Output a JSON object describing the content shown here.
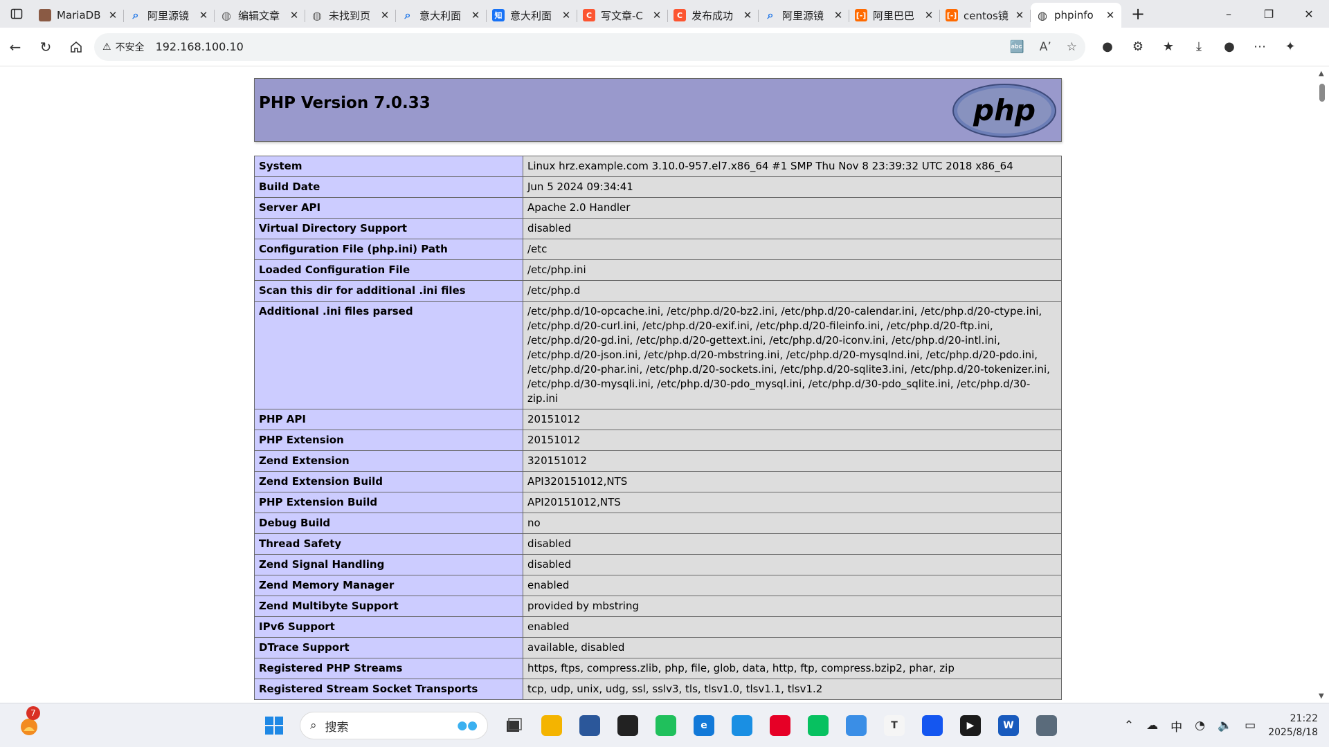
{
  "browser": {
    "tabs": [
      {
        "title": "MariaDB",
        "favicon": "avatar-icon",
        "color": "#8a5a44",
        "glyph": ""
      },
      {
        "title": "阿里源镜",
        "favicon": "search-icon",
        "color": "#1a73e8",
        "glyph": ""
      },
      {
        "title": "编辑文章",
        "favicon": "globe-icon",
        "color": "#666666",
        "glyph": ""
      },
      {
        "title": "未找到页",
        "favicon": "globe-icon",
        "color": "#666666",
        "glyph": ""
      },
      {
        "title": "意大利面",
        "favicon": "search-icon",
        "color": "#1a73e8",
        "glyph": ""
      },
      {
        "title": "意大利面",
        "favicon": "zhihu-icon",
        "color": "#1772f6",
        "glyph": "知"
      },
      {
        "title": "写文章-C",
        "favicon": "csdn-icon",
        "color": "#fc5531",
        "glyph": "C"
      },
      {
        "title": "发布成功",
        "favicon": "csdn-icon",
        "color": "#fc5531",
        "glyph": "C"
      },
      {
        "title": "阿里源镜",
        "favicon": "search-icon",
        "color": "#1a73e8",
        "glyph": ""
      },
      {
        "title": "阿里巴巴",
        "favicon": "aliyun-icon",
        "color": "#ff6a00",
        "glyph": "[-]"
      },
      {
        "title": "centos镜",
        "favicon": "aliyun-icon",
        "color": "#ff6a00",
        "glyph": "[-]"
      },
      {
        "title": "phpinfo",
        "favicon": "globe-icon",
        "color": "#333333",
        "glyph": "",
        "active": true
      }
    ],
    "security_label": "不安全",
    "url": "192.168.100.10"
  },
  "page": {
    "header_title": "PHP Version 7.0.33",
    "logo_text": "php",
    "rows": [
      {
        "k": "System",
        "v": "Linux hrz.example.com 3.10.0-957.el7.x86_64 #1 SMP Thu Nov 8 23:39:32 UTC 2018 x86_64"
      },
      {
        "k": "Build Date",
        "v": "Jun 5 2024 09:34:41"
      },
      {
        "k": "Server API",
        "v": "Apache 2.0 Handler"
      },
      {
        "k": "Virtual Directory Support",
        "v": "disabled"
      },
      {
        "k": "Configuration File (php.ini) Path",
        "v": "/etc"
      },
      {
        "k": "Loaded Configuration File",
        "v": "/etc/php.ini"
      },
      {
        "k": "Scan this dir for additional .ini files",
        "v": "/etc/php.d"
      },
      {
        "k": "Additional .ini files parsed",
        "v": "/etc/php.d/10-opcache.ini, /etc/php.d/20-bz2.ini, /etc/php.d/20-calendar.ini, /etc/php.d/20-ctype.ini, /etc/php.d/20-curl.ini, /etc/php.d/20-exif.ini, /etc/php.d/20-fileinfo.ini, /etc/php.d/20-ftp.ini, /etc/php.d/20-gd.ini, /etc/php.d/20-gettext.ini, /etc/php.d/20-iconv.ini, /etc/php.d/20-intl.ini, /etc/php.d/20-json.ini, /etc/php.d/20-mbstring.ini, /etc/php.d/20-mysqlnd.ini, /etc/php.d/20-pdo.ini, /etc/php.d/20-phar.ini, /etc/php.d/20-sockets.ini, /etc/php.d/20-sqlite3.ini, /etc/php.d/20-tokenizer.ini, /etc/php.d/30-mysqli.ini, /etc/php.d/30-pdo_mysql.ini, /etc/php.d/30-pdo_sqlite.ini, /etc/php.d/30-zip.ini"
      },
      {
        "k": "PHP API",
        "v": "20151012"
      },
      {
        "k": "PHP Extension",
        "v": "20151012"
      },
      {
        "k": "Zend Extension",
        "v": "320151012"
      },
      {
        "k": "Zend Extension Build",
        "v": "API320151012,NTS"
      },
      {
        "k": "PHP Extension Build",
        "v": "API20151012,NTS"
      },
      {
        "k": "Debug Build",
        "v": "no"
      },
      {
        "k": "Thread Safety",
        "v": "disabled"
      },
      {
        "k": "Zend Signal Handling",
        "v": "disabled"
      },
      {
        "k": "Zend Memory Manager",
        "v": "enabled"
      },
      {
        "k": "Zend Multibyte Support",
        "v": "provided by mbstring"
      },
      {
        "k": "IPv6 Support",
        "v": "enabled"
      },
      {
        "k": "DTrace Support",
        "v": "available, disabled"
      },
      {
        "k": "Registered PHP Streams",
        "v": "https, ftps, compress.zlib, php, file, glob, data, http, ftp, compress.bzip2, phar, zip"
      },
      {
        "k": "Registered Stream Socket Transports",
        "v": "tcp, udp, unix, udg, ssl, sslv3, tls, tlsv1.0, tlsv1.1, tlsv1.2"
      }
    ]
  },
  "taskbar": {
    "weather_badge": "7",
    "search_placeholder": "搜索",
    "apps": [
      {
        "name": "file-explorer-icon",
        "color": "#f4b400",
        "glyph": ""
      },
      {
        "name": "store-icon",
        "color": "#2b579a",
        "glyph": ""
      },
      {
        "name": "app-cube-icon",
        "color": "#222222",
        "glyph": ""
      },
      {
        "name": "green-app-icon",
        "color": "#20c05c",
        "glyph": ""
      },
      {
        "name": "edge-icon",
        "color": "#1279d8",
        "glyph": "e"
      },
      {
        "name": "screenshot-app-icon",
        "color": "#1a8fe3",
        "glyph": ""
      },
      {
        "name": "netease-music-icon",
        "color": "#e60026",
        "glyph": ""
      },
      {
        "name": "wechat-icon",
        "color": "#07c160",
        "glyph": ""
      },
      {
        "name": "notepad-icon",
        "color": "#3a8ee6",
        "glyph": ""
      },
      {
        "name": "typora-icon",
        "color": "#f5f5f5",
        "glyph": "T"
      },
      {
        "name": "lark-icon",
        "color": "#1456f0",
        "glyph": ""
      },
      {
        "name": "media-player-icon",
        "color": "#1b1b1b",
        "glyph": "▶"
      },
      {
        "name": "word-icon",
        "color": "#185abd",
        "glyph": "W"
      },
      {
        "name": "control-panel-icon",
        "color": "#5a6b7b",
        "glyph": ""
      }
    ],
    "ime": "中",
    "time": "21:22",
    "date": "2025/8/18"
  }
}
